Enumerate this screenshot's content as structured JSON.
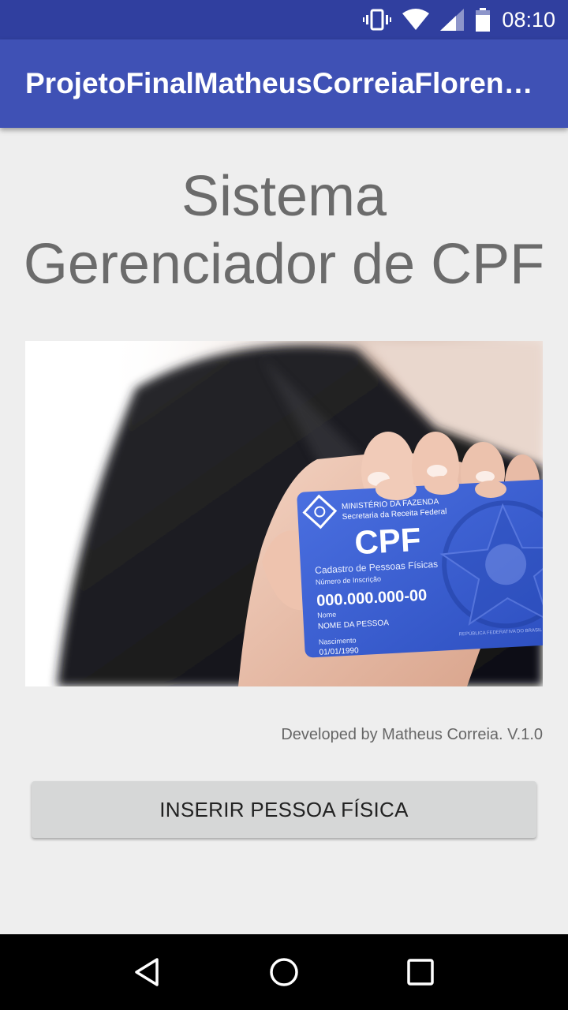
{
  "status_bar": {
    "time": "08:10",
    "icons": [
      "vibrate-icon",
      "wifi-icon",
      "signal-icon",
      "battery-icon"
    ]
  },
  "app_bar": {
    "title": "ProjetoFinalMatheusCorreiaFlorencio"
  },
  "main": {
    "headline_line1": "Sistema",
    "headline_line2": "Gerenciador de CPF",
    "credit": "Developed by Matheus Correia. V.1.0",
    "insert_button": "INSERIR PESSOA FÍSICA"
  },
  "card": {
    "ministry": "MINISTÉRIO DA FAZENDA",
    "secretariat": "Secretaria da Receita Federal",
    "brand": "CPF",
    "subtitle": "Cadastro de Pessoas Físicas",
    "number_label": "Número de Inscrição",
    "number": "000.000.000-00",
    "name_label": "Nome",
    "name": "NOME DA PESSOA",
    "birth_label": "Nascimento",
    "birth": "01/01/1990",
    "seal_text": "REPÚBLICA FEDERATIVA DO BRASIL"
  },
  "nav_bar": {
    "icons": [
      "back-icon",
      "home-icon",
      "recents-icon"
    ]
  },
  "colors": {
    "status_bar": "#303f9f",
    "app_bar": "#3f51b5",
    "background": "#eeeeee",
    "button": "#d6d7d7",
    "card_blue": "#3a5fd1"
  }
}
